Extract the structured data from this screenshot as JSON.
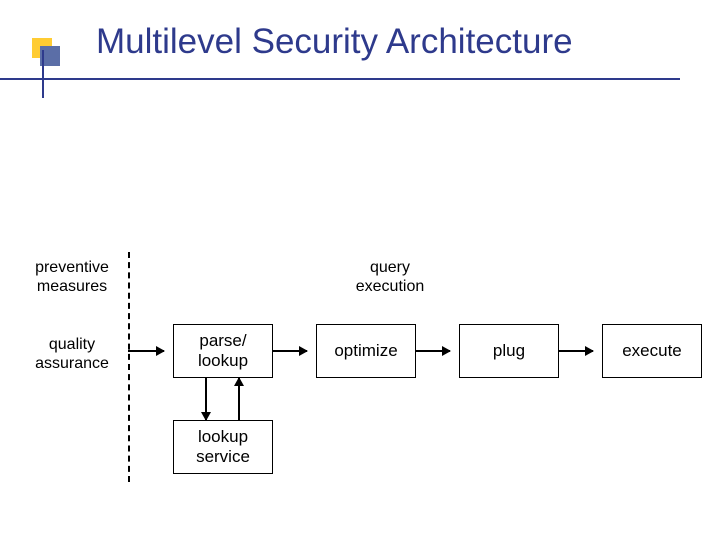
{
  "title": "Multilevel Security Architecture",
  "labels": {
    "preventive": "preventive\nmeasures",
    "query_exec": "query\nexecution",
    "quality": "quality\nassurance"
  },
  "boxes": {
    "parse": "parse/\nlookup",
    "optimize": "optimize",
    "plug": "plug",
    "execute": "execute",
    "lookup_service": "lookup\nservice"
  }
}
